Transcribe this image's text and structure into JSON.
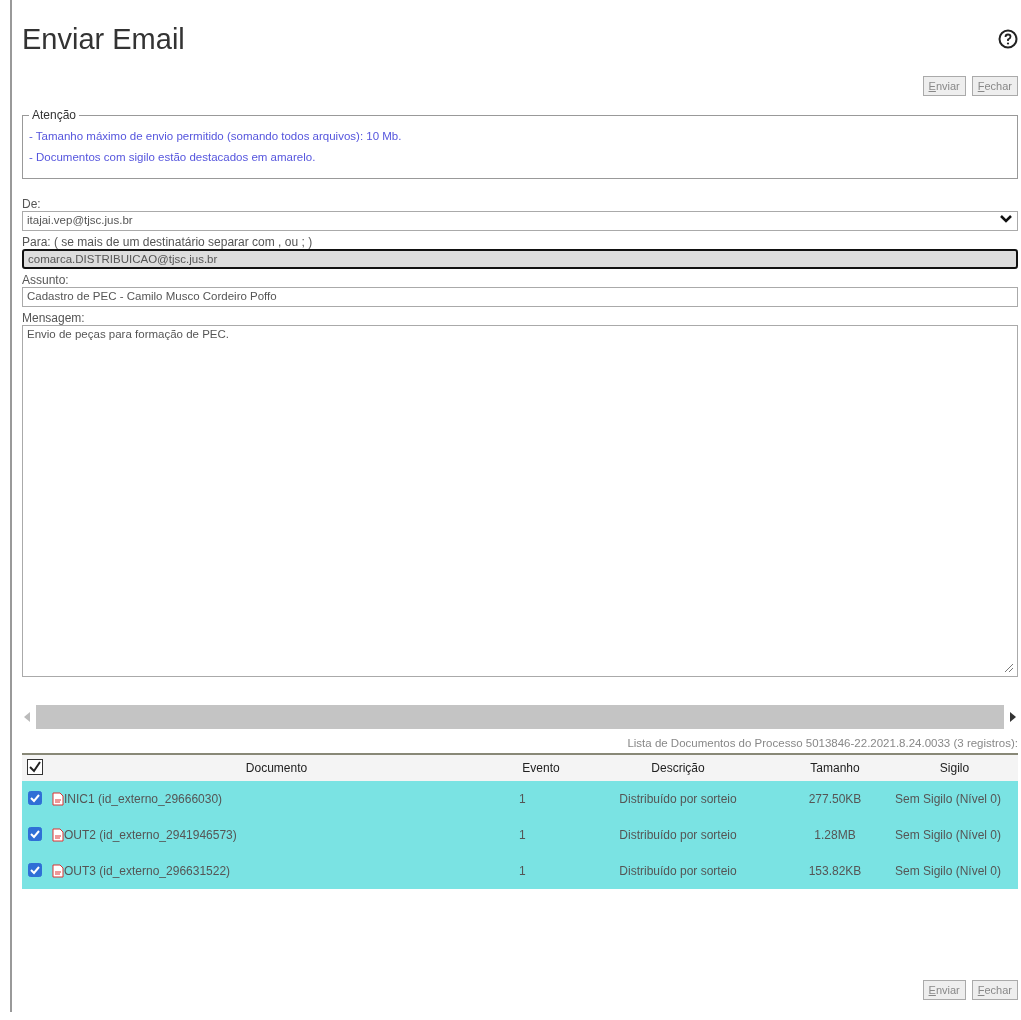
{
  "title": "Enviar Email",
  "top_buttons": [
    "Enviar",
    "Fechar"
  ],
  "notice": {
    "legend": "Atenção",
    "lines": [
      "- Tamanho máximo de envio permitido (somando todos arquivos): 10 Mb.",
      "- Documentos com sigilo estão destacados em amarelo."
    ]
  },
  "fields": [
    {
      "kind": "select",
      "label": "De:",
      "value": "itajai.vep@tjsc.jus.br",
      "focused": false
    },
    {
      "kind": "input",
      "label": "Para: ( se mais de um destinatário separar com , ou ; )",
      "value": "comarca.DISTRIBUICAO@tjsc.jus.br",
      "focused": true
    },
    {
      "kind": "input",
      "label": "Assunto:",
      "value": "Cadastro de PEC - Camilo Musco Cordeiro Poffo",
      "focused": false
    },
    {
      "kind": "textarea",
      "label": "Mensagem:",
      "value": "Envio de peças para formação de PEC.",
      "focused": false
    }
  ],
  "table": {
    "caption": "Lista de Documentos do Processo 5013846-22.2021.8.24.0033 (3 registros):",
    "all_checked": true,
    "columns": [
      "Documento",
      "Evento",
      "Descrição",
      "Tamanho",
      "Sigilo"
    ],
    "rows": [
      {
        "checked": true,
        "documento": "INIC1 (id_externo_29666030)",
        "evento": "1",
        "descricao": "Distribuído por sorteio",
        "tamanho": "277.50KB",
        "sigilo": "Sem Sigilo (Nível 0)"
      },
      {
        "checked": true,
        "documento": "OUT2 (id_externo_2941946573)",
        "evento": "1",
        "descricao": "Distribuído por sorteio",
        "tamanho": "1.28MB",
        "sigilo": "Sem Sigilo (Nível 0)"
      },
      {
        "checked": true,
        "documento": "OUT3 (id_externo_296631522)",
        "evento": "1",
        "descricao": "Distribuído por sorteio",
        "tamanho": "153.82KB",
        "sigilo": "Sem Sigilo (Nível 0)"
      }
    ]
  },
  "bottom_buttons": [
    "Enviar",
    "Fechar"
  ]
}
